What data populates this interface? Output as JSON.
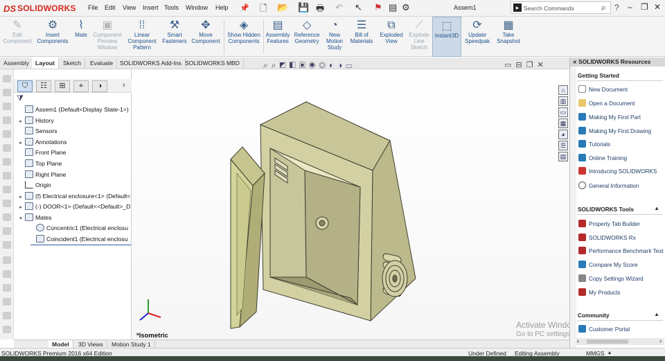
{
  "app": {
    "logo_ds": "DS",
    "logo_name": "SOLIDWORKS",
    "doc_title": "Assem1"
  },
  "menu": [
    "File",
    "Edit",
    "View",
    "Insert",
    "Tools",
    "Window",
    "Help"
  ],
  "search": {
    "placeholder": "Search Commands"
  },
  "commands": [
    {
      "label": "Edit Component",
      "icon": "edit-component-icon",
      "glyph": "✎",
      "enabled": false
    },
    {
      "label": "Insert Components",
      "icon": "insert-components-icon",
      "glyph": "⚙",
      "enabled": true
    },
    {
      "label": "Mate",
      "icon": "mate-icon",
      "glyph": "📎",
      "enabled": true
    },
    {
      "label": "Component Preview Window",
      "icon": "preview-window-icon",
      "glyph": "▣",
      "enabled": false
    },
    {
      "label": "Linear Component Pattern",
      "icon": "linear-pattern-icon",
      "glyph": "⁞⁞",
      "enabled": true
    },
    {
      "label": "Smart Fasteners",
      "icon": "smart-fasteners-icon",
      "glyph": "⚒",
      "enabled": true
    },
    {
      "label": "Move Component",
      "icon": "move-component-icon",
      "glyph": "✥",
      "enabled": true
    },
    {
      "label": "Show Hidden Components",
      "icon": "show-hidden-icon",
      "glyph": "◈",
      "enabled": true
    },
    {
      "label": "Assembly Features",
      "icon": "assembly-features-icon",
      "glyph": "▤",
      "enabled": true
    },
    {
      "label": "Reference Geometry",
      "icon": "reference-geometry-icon",
      "glyph": "◇",
      "enabled": true
    },
    {
      "label": "New Motion Study",
      "icon": "motion-study-icon",
      "glyph": "◔",
      "enabled": true
    },
    {
      "label": "Bill of Materials",
      "icon": "bom-icon",
      "glyph": "☰",
      "enabled": true
    },
    {
      "label": "Exploded View",
      "icon": "exploded-view-icon",
      "glyph": "⧉",
      "enabled": true
    },
    {
      "label": "Explode Line Sketch",
      "icon": "explode-line-icon",
      "glyph": "⟋",
      "enabled": false
    },
    {
      "label": "Instant3D",
      "icon": "instant3d-icon",
      "glyph": "⬚",
      "enabled": true,
      "active": true
    },
    {
      "label": "Update Speedpak",
      "icon": "speedpak-icon",
      "glyph": "⟳",
      "enabled": true
    },
    {
      "label": "Take Snapshot",
      "icon": "snapshot-icon",
      "glyph": "📷",
      "enabled": true
    }
  ],
  "tabs": [
    "Assembly",
    "Layout",
    "Sketch",
    "Evaluate",
    "SOLIDWORKS Add-Ins",
    "SOLIDWORKS MBD"
  ],
  "active_tab": "Layout",
  "tree": [
    {
      "label": "Assem1  (Default<Display State-1>)",
      "depth": 0,
      "expander": "",
      "icon": "assembly-icon"
    },
    {
      "label": "History",
      "depth": 1,
      "expander": "▸",
      "icon": "history-icon"
    },
    {
      "label": "Sensors",
      "depth": 1,
      "expander": "",
      "icon": "sensors-icon"
    },
    {
      "label": "Annotations",
      "depth": 1,
      "expander": "▸",
      "icon": "annotations-icon"
    },
    {
      "label": "Front Plane",
      "depth": 1,
      "expander": "",
      "icon": "plane-icon"
    },
    {
      "label": "Top Plane",
      "depth": 1,
      "expander": "",
      "icon": "plane-icon"
    },
    {
      "label": "Right Plane",
      "depth": 1,
      "expander": "",
      "icon": "plane-icon"
    },
    {
      "label": "Origin",
      "depth": 1,
      "expander": "",
      "icon": "origin-icon"
    },
    {
      "label": "(f) Electrical enclosure<1> (Default<",
      "depth": 1,
      "expander": "▸",
      "icon": "part-icon"
    },
    {
      "label": "(-) DOOR<1> (Default<<Default>_D",
      "depth": 1,
      "expander": "▸",
      "icon": "part-icon"
    },
    {
      "label": "Mates",
      "depth": 1,
      "expander": "▾",
      "icon": "mates-icon"
    },
    {
      "label": "Concentric1 (Electrical enclosu",
      "depth": 2,
      "expander": "",
      "icon": "concentric-mate-icon"
    },
    {
      "label": "Coincident1 (Electrical enclosu",
      "depth": 2,
      "expander": "",
      "icon": "coincident-mate-icon"
    }
  ],
  "viewport": {
    "view_label": "*Isometric",
    "watermark_1": "Activate Windows",
    "watermark_2": "Go to PC settings to activate Windows."
  },
  "bottom_tabs": [
    "Model",
    "3D Views",
    "Motion Study 1"
  ],
  "status": {
    "edition": "SOLIDWORKS Premium 2016 x64 Edition",
    "define": "Under Defined",
    "mode": "Editing Assembly",
    "units": "MMGS"
  },
  "pane": {
    "title": "SOLIDWORKS Resources",
    "sections": [
      {
        "title": "Getting Started",
        "items": [
          "New Document",
          "Open a Document",
          "Making My First Part",
          "Making My First Drawing",
          "Tutorials",
          "Online Training",
          "Introducing SOLIDWORKS",
          "General Information"
        ]
      },
      {
        "title": "SOLIDWORKS Tools",
        "items": [
          "Property Tab Builder",
          "SOLIDWORKS Rx",
          "Performance Benchmark Test",
          "Compare My Score",
          "Copy Settings Wizard",
          "My Products"
        ]
      },
      {
        "title": "Community",
        "items": [
          "Customer Portal"
        ]
      }
    ]
  },
  "colors": {
    "brand": "#d52b1e",
    "enclosure": "#c9c79a",
    "door": "#d4d49a"
  }
}
